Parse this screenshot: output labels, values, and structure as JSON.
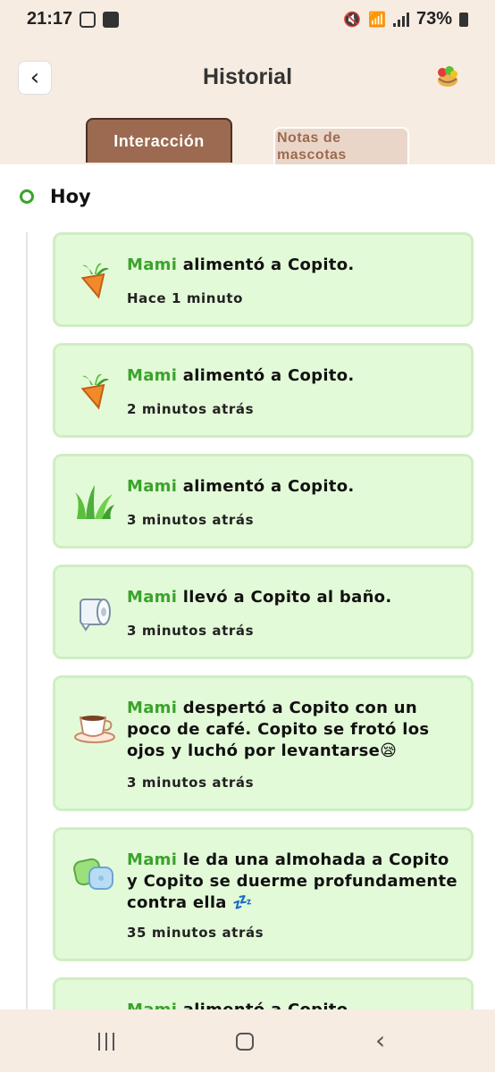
{
  "status_bar": {
    "time": "21:17",
    "battery": "73%"
  },
  "header": {
    "title": "Historial",
    "back_icon": "‹"
  },
  "tabs": [
    {
      "label": "Interacción",
      "active": true
    },
    {
      "label": "Notas de mascotas",
      "active": false
    }
  ],
  "day": {
    "label": "Hoy"
  },
  "entries": [
    {
      "icon": "carrot-icon",
      "who": "Mami",
      "text": " alimentó a Copito.",
      "time": "Hace 1 minuto"
    },
    {
      "icon": "carrot-icon",
      "who": "Mami",
      "text": " alimentó a Copito.",
      "time": "2 minutos atrás"
    },
    {
      "icon": "grass-icon",
      "who": "Mami",
      "text": " alimentó a Copito.",
      "time": "3 minutos atrás"
    },
    {
      "icon": "toilet-paper-icon",
      "who": "Mami",
      "text": " llevó a Copito al baño.",
      "time": "3 minutos atrás"
    },
    {
      "icon": "coffee-cup-icon",
      "who": "Mami",
      "text": " despertó a Copito con un poco de café. Copito se frotó los ojos y luchó por levantarse😪",
      "time": "3 minutos atrás"
    },
    {
      "icon": "pillow-icon",
      "who": "Mami",
      "text": " le da una almohada a Copito y Copito se duerme profundamente contra ella 💤",
      "time": "35 minutos atrás"
    },
    {
      "icon": "food-icon",
      "who": "Mami",
      "text": " alimentó a Copito.",
      "time": ""
    }
  ],
  "colors": {
    "accent_green": "#3aa32b",
    "card_bg": "#e3fad8",
    "tab_brown": "#9c6a50"
  }
}
